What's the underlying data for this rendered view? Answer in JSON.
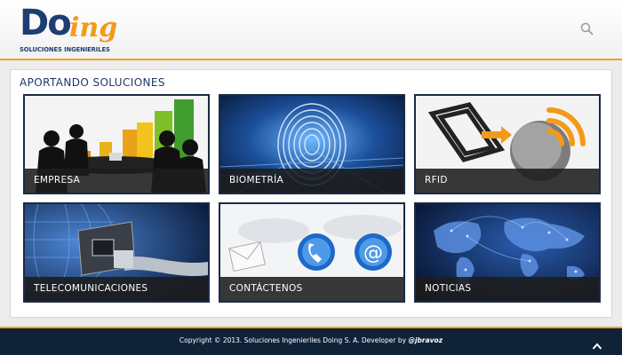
{
  "header": {
    "logo": {
      "brand_main": "Do",
      "brand_script": "ing",
      "tagline": "SOLUCIONES INGENIERILES"
    },
    "search_icon": "search-icon"
  },
  "main": {
    "section_title": "APORTANDO SOLUCIONES",
    "tiles": [
      {
        "label": "EMPRESA",
        "image": "business-people-chart"
      },
      {
        "label": "BIOMETRÍA",
        "image": "fingerprint"
      },
      {
        "label": "RFID",
        "image": "rfid-card-signal"
      },
      {
        "label": "TELECOMUNICACIONES",
        "image": "network-cable-globe"
      },
      {
        "label": "CONTÁCTENOS",
        "image": "mail-phone-at-icons"
      },
      {
        "label": "NOTICIAS",
        "image": "glowing-world-map"
      }
    ]
  },
  "footer": {
    "copyright": "Copyright © 2013. Soluciones Ingenieriles Doing S. A.  Developer by",
    "developer": "@jbravoz",
    "up_icon": "chevron-up-icon"
  },
  "colors": {
    "brand_blue": "#1d3d73",
    "brand_orange": "#f39a1a",
    "footer_bg": "#0f2238",
    "tile_label_bg": "#1c1c1c"
  }
}
